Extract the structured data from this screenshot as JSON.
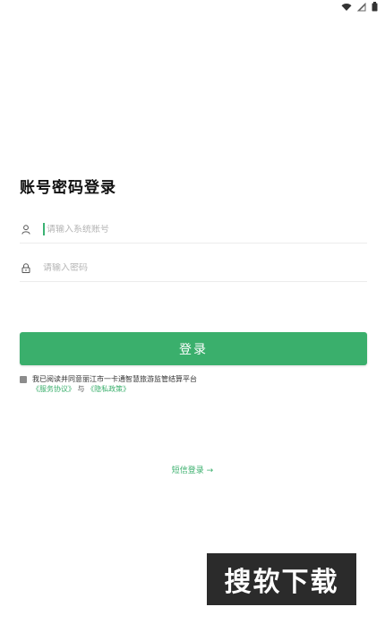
{
  "login": {
    "title": "账号密码登录",
    "account_placeholder": "请输入系统账号",
    "password_placeholder": "请输入密码",
    "login_button": "登录",
    "agreement_text": "我已阅读并同意丽江市一卡通智慧旅游监管结算平台",
    "service_agreement": "《服务协议》",
    "and_text": "与",
    "privacy_policy": "《隐私政策》",
    "sms_login": "短信登录 →"
  },
  "watermark": {
    "text": "搜软下载"
  },
  "colors": {
    "accent": "#3aaf6c"
  },
  "icons": [
    "wifi-icon",
    "signal-icon",
    "battery-icon",
    "user-icon",
    "lock-icon"
  ]
}
